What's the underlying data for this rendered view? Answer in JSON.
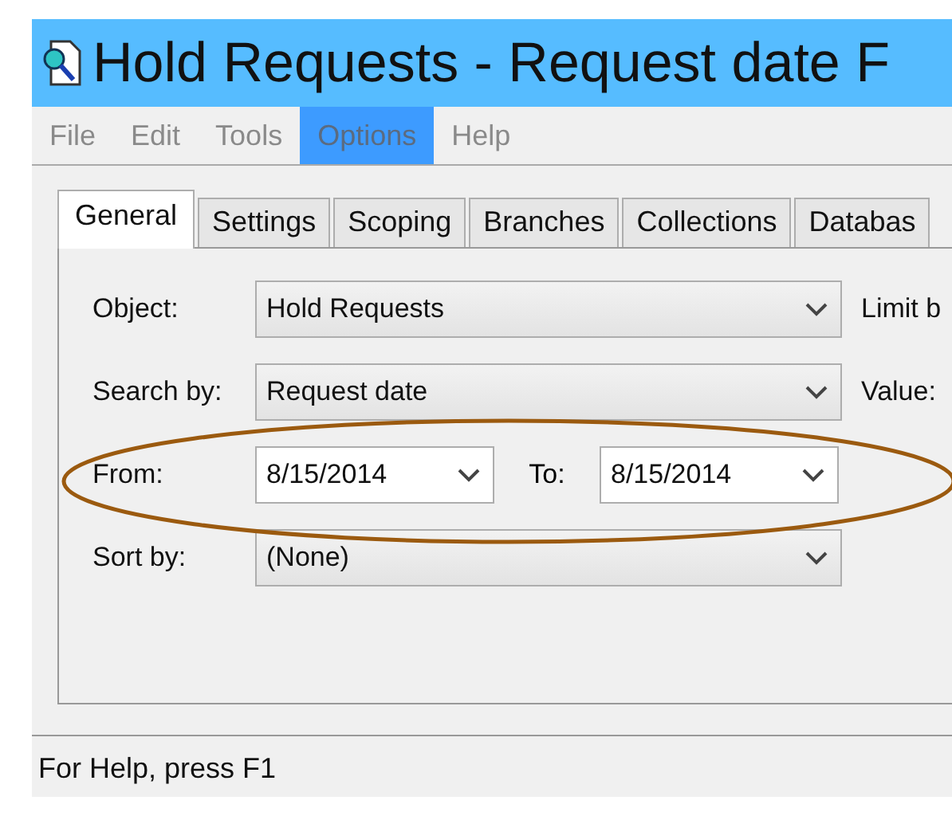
{
  "window": {
    "title": "Hold Requests - Request date F"
  },
  "menu": [
    {
      "label": "File",
      "selected": false
    },
    {
      "label": "Edit",
      "selected": false
    },
    {
      "label": "Tools",
      "selected": false
    },
    {
      "label": "Options",
      "selected": true
    },
    {
      "label": "Help",
      "selected": false
    }
  ],
  "tabs": [
    {
      "label": "General",
      "selected": true
    },
    {
      "label": "Settings",
      "selected": false
    },
    {
      "label": "Scoping",
      "selected": false
    },
    {
      "label": "Branches",
      "selected": false
    },
    {
      "label": "Collections",
      "selected": false
    },
    {
      "label": "Databas",
      "selected": false
    }
  ],
  "form": [
    {
      "label": "Object:",
      "fields": [
        {
          "kind": "combo",
          "value": "Hold Requests"
        }
      ],
      "side_label": "Limit b"
    },
    {
      "label": "Search by:",
      "fields": [
        {
          "kind": "combo",
          "value": "Request date"
        }
      ],
      "side_label": "Value:"
    },
    {
      "label": "From:",
      "fields": [
        {
          "kind": "date",
          "value": "8/15/2014"
        },
        {
          "kind": "label",
          "text": "To:"
        },
        {
          "kind": "date",
          "value": "8/15/2014"
        }
      ]
    },
    {
      "label": "Sort by:",
      "fields": [
        {
          "kind": "combo",
          "value": "(None)"
        }
      ]
    }
  ],
  "status_bar": "For Help, press F1"
}
